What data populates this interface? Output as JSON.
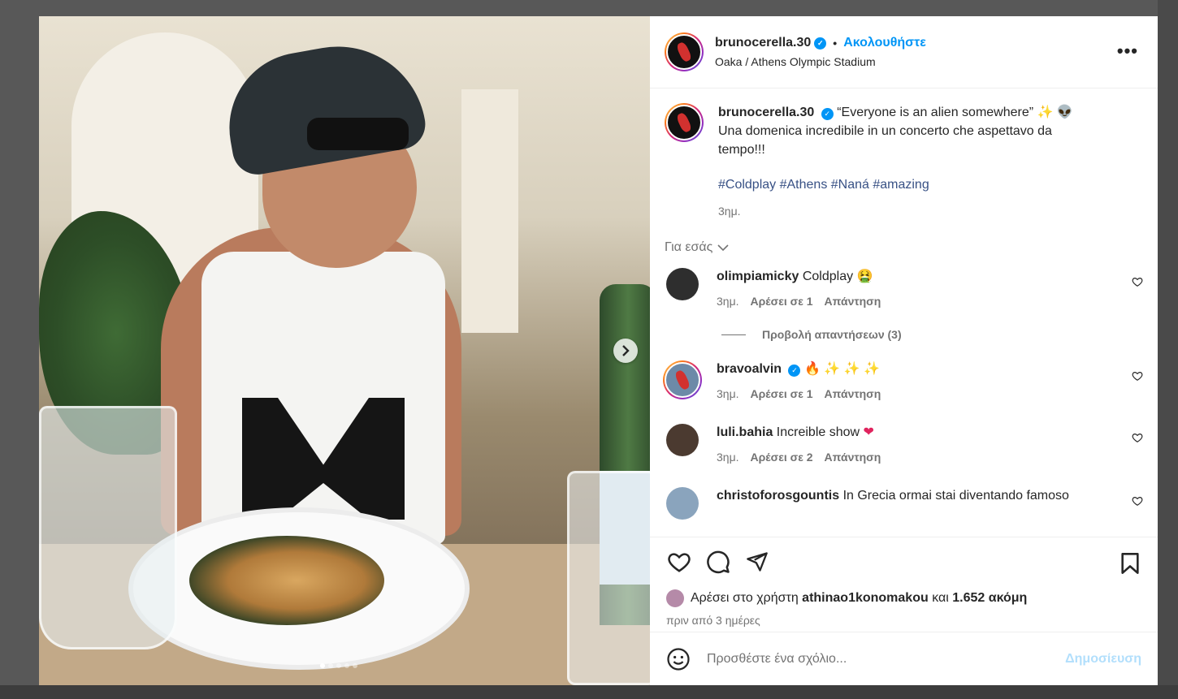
{
  "post": {
    "username": "brunocerella.30",
    "follow_label": "Ακολουθήστε",
    "location": "Oaka / Athens Olympic Stadium",
    "more_label": "•••",
    "caption_line1": "“Everyone is an alien somewhere” ✨ 👽",
    "caption_line2": "Una domenica incredibile in un concerto che aspettavo da tempo!!!",
    "hashtags": "#Coldplay #Athens #Naná #amazing",
    "time": "3ημ.",
    "for_you": "Για εσάς"
  },
  "comments": [
    {
      "user": "olimpiamicky",
      "text": "Coldplay 🤮",
      "time": "3ημ.",
      "likes": "Αρέσει σε 1",
      "reply": "Απάντηση"
    },
    {
      "user": "bravoalvin",
      "text": "",
      "time": "3ημ.",
      "likes": "Αρέσει σε 1",
      "reply": "Απάντηση",
      "emoji1": "🔥",
      "emoji2": "✨ ✨ ✨"
    },
    {
      "user": "luli.bahia",
      "text": "Increible show",
      "emoji": "❤",
      "time": "3ημ.",
      "likes": "Αρέσει σε 2",
      "reply": "Απάντηση"
    },
    {
      "user": "christoforosgountis",
      "text": "In Grecia ormai stai diventando famoso"
    }
  ],
  "view_replies": "Προβολή απαντήσεων (3)",
  "likes": {
    "prefix": "Αρέσει στο χρήστη",
    "user": "athinao1konomakou",
    "middle": "και",
    "count": "1.652 ακόμη"
  },
  "ago": "πριν από 3 ημέρες",
  "compose": {
    "placeholder": "Προσθέστε ένα σχόλιο...",
    "post_label": "Δημοσίευση"
  },
  "carousel": {
    "slide_count": 5,
    "active_index": 0
  },
  "colors": {
    "accent": "#0095f6",
    "hashtag": "#385185",
    "muted": "#737373",
    "post_disabled": "#b2dffc"
  }
}
